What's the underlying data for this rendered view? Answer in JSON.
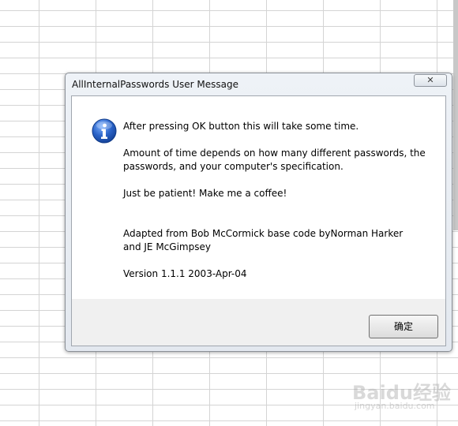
{
  "dialog": {
    "title": "AllInternalPasswords User Message",
    "close_label": "✕",
    "icon": "info-icon",
    "message": {
      "line1": "After pressing OK button this will take some time.",
      "line2": "Amount of time depends on how many different passwords, the",
      "line3": "passwords, and your computer's specification.",
      "line4": "Just be patient! Make me a coffee!",
      "line5": "Adapted from Bob McCormick base code byNorman Harker",
      "line6": "and JE McGimpsey",
      "line7": "Version 1.1.1 2003-Apr-04"
    },
    "ok_label": "确定"
  },
  "watermark": {
    "logo_text": "Baidu经验",
    "url_text": "jingyan.baidu.com"
  },
  "colors": {
    "grid_line": "#d4d4d4",
    "icon_blue": "#1f56b8"
  }
}
